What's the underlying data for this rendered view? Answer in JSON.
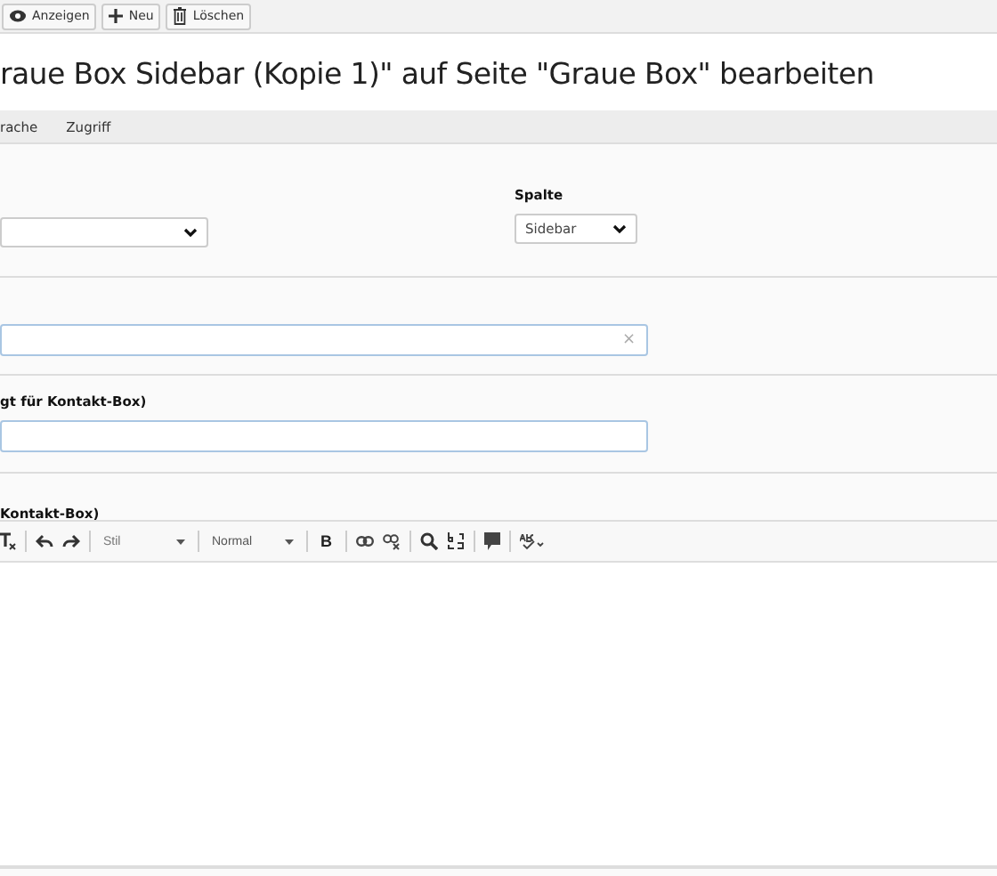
{
  "toolbar": {
    "buttons": [
      {
        "kind": "eye",
        "label": "Anzeigen"
      },
      {
        "kind": "plus",
        "label": "Neu"
      },
      {
        "kind": "trash",
        "label": "Löschen"
      }
    ]
  },
  "title": "raue Box Sidebar (Kopie 1)\" auf Seite \"Graue Box\" bearbeiten",
  "tabs": [
    {
      "label": "rache",
      "selected": false
    },
    {
      "label": "Zugriff",
      "selected": false
    }
  ],
  "column_field": {
    "label": "Spalte",
    "value": "Sidebar"
  },
  "field_2": {
    "clear_button": "×"
  },
  "field_3": {
    "label": "gt für Kontakt-Box)"
  },
  "editor": {
    "label": "Kontakt-Box)",
    "style_dropdown": "Stil",
    "format_dropdown": "Normal",
    "bold_button": "B"
  }
}
